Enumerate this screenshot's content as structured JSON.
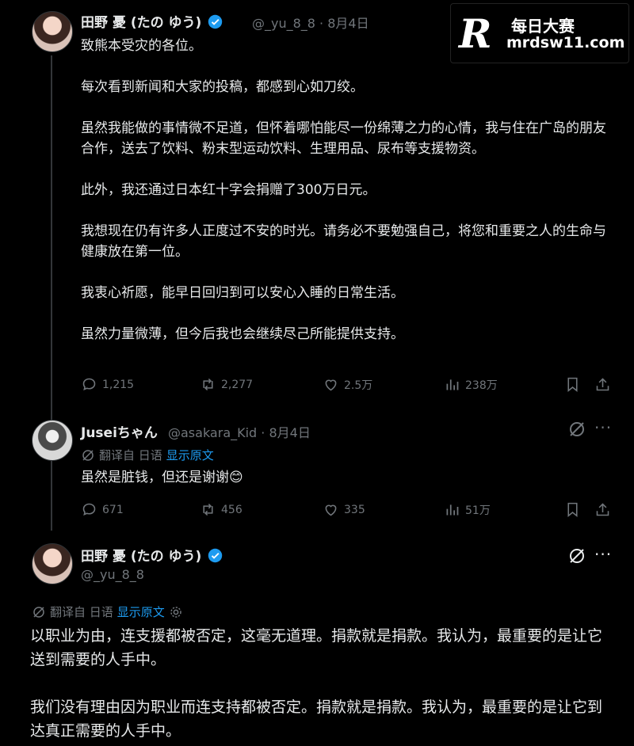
{
  "tweet1": {
    "name": "田野 憂 (たの ゆう)",
    "handle_date": "@_yu_8_8 · 8月4日",
    "paragraphs": [
      "致熊本受灾的各位。",
      "每次看到新闻和大家的投稿，都感到心如刀绞。",
      "虽然我能做的事情微不足道，但怀着哪怕能尽一份绵薄之力的心情，我与住在广岛的朋友合作，送去了饮料、粉末型运动饮料、生理用品、尿布等支援物资。",
      "此外，我还通过日本红十字会捐赠了300万日元。",
      "我想现在仍有许多人正度过不安的时光。请务必不要勉强自己，将您和重要之人的生命与健康放在第一位。",
      "我衷心祈愿，能早日回归到可以安心入睡的日常生活。",
      "虽然力量微薄，但今后我也会继续尽己所能提供支持。"
    ],
    "stats": {
      "replies": "1,215",
      "reposts": "2,277",
      "likes": "2.5万",
      "views": "238万"
    }
  },
  "tweet2": {
    "name": "Juseiちゃん",
    "handle_date": "@asakara_Kid · 8月4日",
    "translated_from": "翻译自 日语",
    "show_original": "显示原文",
    "text": "虽然是脏钱，但还是谢谢😊",
    "stats": {
      "replies": "671",
      "reposts": "456",
      "likes": "335",
      "views": "51万"
    }
  },
  "tweet3": {
    "name": "田野 憂 (たの ゆう)",
    "handle": "@_yu_8_8",
    "translated_from": "翻译自 日语",
    "show_original": "显示原文",
    "paragraphs": [
      "以职业为由，连支援都被否定，这毫无道理。捐款就是捐款。我认为，最重要的是让它送到需要的人手中。",
      "我们没有理由因为职业而连支持都被否定。捐款就是捐款。我认为，最重要的是让它到达真正需要的人手中。"
    ]
  },
  "watermark": {
    "logo": "R",
    "cn": "每日大赛",
    "url": "mrdsw11.com"
  },
  "colors": {
    "accent": "#1d9bf0",
    "muted": "#71767b",
    "text": "#e7e9ea",
    "background": "#000000"
  }
}
